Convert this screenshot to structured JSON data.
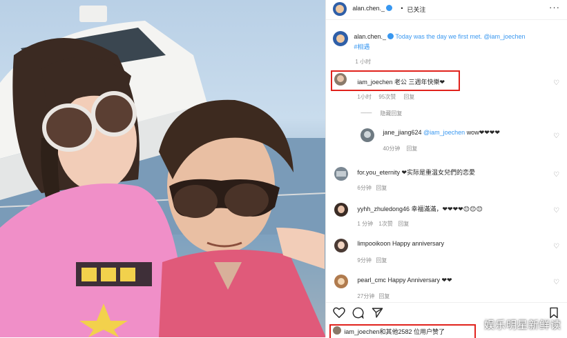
{
  "header": {
    "username": "alan.chen._",
    "follow_status": "已关注",
    "more_icon": "more-horizontal-icon"
  },
  "caption": {
    "username": "alan.chen._",
    "text": "Today was the day we first met.",
    "mention": "@iam_joechen",
    "hashtag": "#相遇",
    "time": "1 小时"
  },
  "comments": [
    {
      "username": "iam_joechen",
      "text": "老公 三週年快樂❤",
      "time": "1小时",
      "likes": "95次赞",
      "reply": "回复",
      "toggle": "隐藏回复"
    },
    {
      "username": "jane_jiang624",
      "mention": "@iam_joechen",
      "text": "wow❤❤❤❤",
      "time": "40分钟",
      "reply": "回复"
    },
    {
      "username": "for.you_eternity",
      "text": "❤实际是重温女兒們的恋愛",
      "time": "6分钟",
      "reply": "回复"
    },
    {
      "username": "yyhh_zhuledong46",
      "text": "幸福滿滿，❤❤❤❤😊😊😊",
      "time": "1 分钟",
      "likes": "1次赞",
      "reply": "回复"
    },
    {
      "username": "limpooikoon",
      "text": "Happy anniversary",
      "time": "9分钟",
      "reply": "回复"
    },
    {
      "username": "pearl_cmc",
      "text": "Happy Anniversary ❤❤",
      "time": "27分钟",
      "reply": "回复"
    }
  ],
  "likes_line": "iam_joechen和其他2582 位用户赞了",
  "watermark": "娱乐明星新鲜读",
  "colors": {
    "accent": "#3897f0",
    "highlight": "#e0211b"
  }
}
